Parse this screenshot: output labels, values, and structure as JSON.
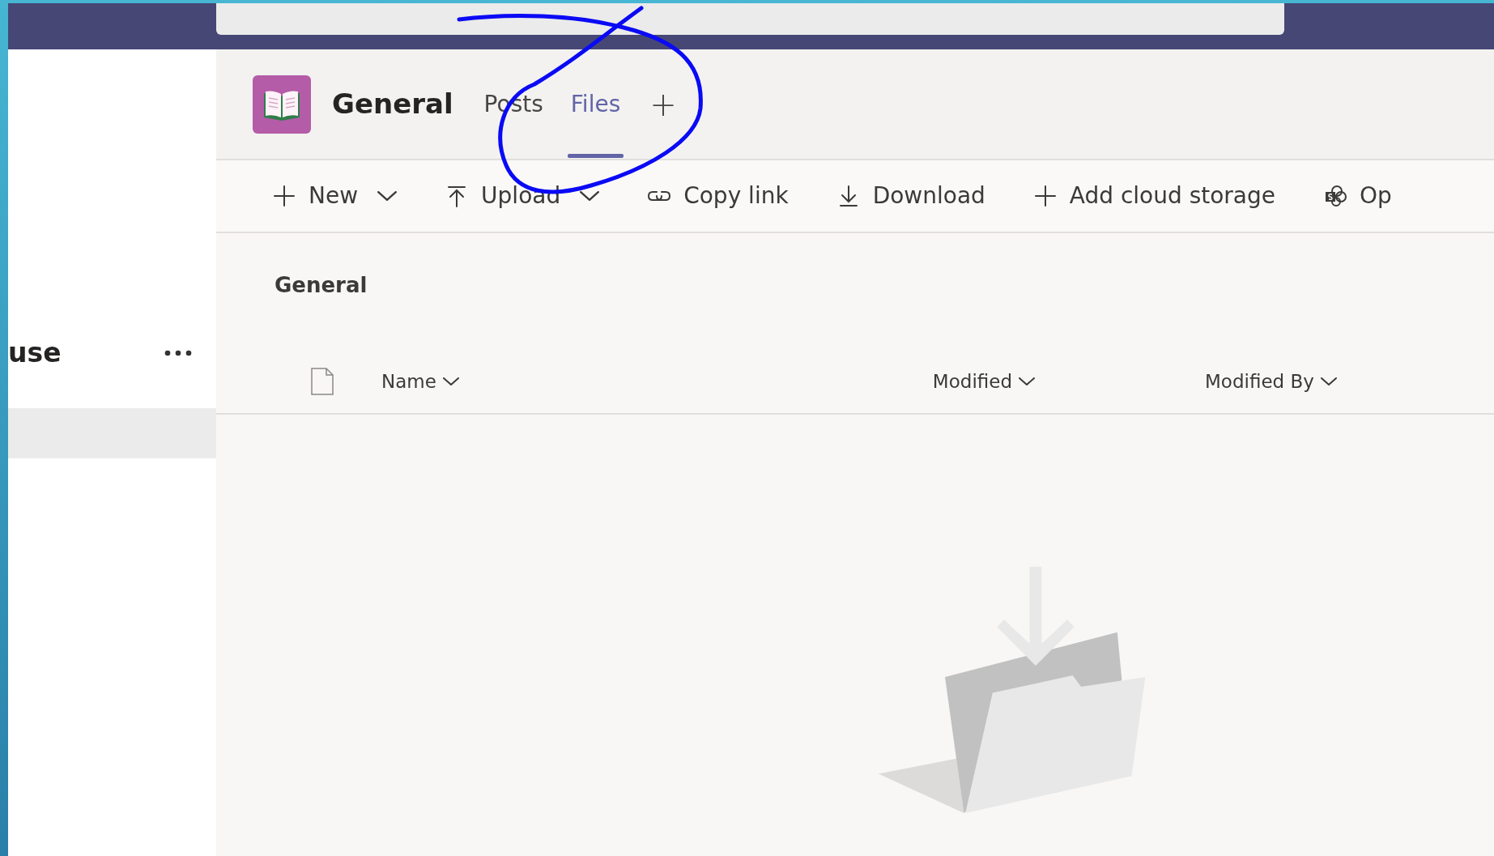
{
  "sidebar": {
    "title": "use"
  },
  "channel": {
    "name": "General",
    "tabs": [
      {
        "label": "Posts",
        "selected": false
      },
      {
        "label": "Files",
        "selected": true
      }
    ],
    "add_tab": "+"
  },
  "toolbar": [
    {
      "kind": "plus",
      "label": "New",
      "dropdown": true
    },
    {
      "kind": "upload",
      "label": "Upload",
      "dropdown": true
    },
    {
      "kind": "link",
      "label": "Copy link",
      "dropdown": false
    },
    {
      "kind": "download",
      "label": "Download",
      "dropdown": false
    },
    {
      "kind": "plus",
      "label": "Add cloud storage",
      "dropdown": false
    },
    {
      "kind": "sharepoint",
      "label": "Op",
      "dropdown": false
    }
  ],
  "breadcrumb": "General",
  "columns": [
    {
      "label": "Name"
    },
    {
      "label": "Modified"
    },
    {
      "label": "Modified By"
    }
  ]
}
